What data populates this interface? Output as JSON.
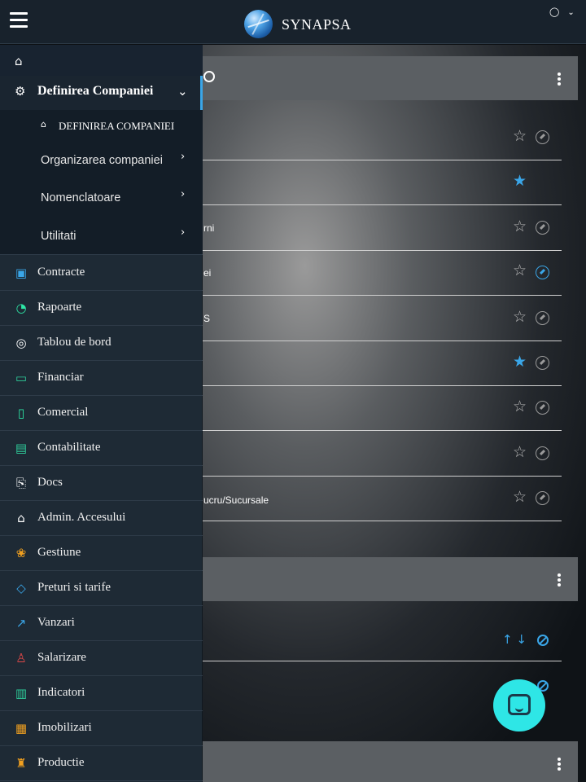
{
  "app": {
    "brand": "SYNAPSA",
    "user_icon": "user-icon",
    "user_caret": "⌄"
  },
  "sidebar": {
    "home_icon": "⌂",
    "section": {
      "label": "Definirea Companiei",
      "icon": "⚙",
      "chevron": "⌄"
    },
    "active_sub": {
      "label": "DEFINIREA COMPANIEI",
      "icon": "⌂"
    },
    "subitems": [
      {
        "label": "Organizarea companiei",
        "arrow": "›"
      },
      {
        "label": "Nomenclatoare",
        "arrow": "›"
      },
      {
        "label": "Utilitati",
        "arrow": "›"
      }
    ],
    "items": [
      {
        "label": "Contracte",
        "icon": "▣",
        "color": "#3aa6e8"
      },
      {
        "label": "Rapoarte",
        "icon": "◔",
        "color": "#2ee6a6"
      },
      {
        "label": "Tablou de bord",
        "icon": "◎",
        "color": "#ffffff"
      },
      {
        "label": "Financiar",
        "icon": "▭",
        "color": "#2ecc9a"
      },
      {
        "label": "Comercial",
        "icon": "▯",
        "color": "#2ee6a6"
      },
      {
        "label": "Contabilitate",
        "icon": "▤",
        "color": "#2ecc9a"
      },
      {
        "label": "Docs",
        "icon": "⎘",
        "color": "#ffffff"
      },
      {
        "label": "Admin. Accesului",
        "icon": "⌂",
        "color": "#ffffff"
      },
      {
        "label": "Gestiune",
        "icon": "❀",
        "color": "#f0a020"
      },
      {
        "label": "Preturi si tarife",
        "icon": "◇",
        "color": "#3aa6e8"
      },
      {
        "label": "Vanzari",
        "icon": "↗",
        "color": "#3aa6e8"
      },
      {
        "label": "Salarizare",
        "icon": "♙",
        "color": "#e04848"
      },
      {
        "label": "Indicatori",
        "icon": "▥",
        "color": "#2ecc9a"
      },
      {
        "label": "Imobilizari",
        "icon": "▦",
        "color": "#f0a020"
      },
      {
        "label": "Productie",
        "icon": "♜",
        "color": "#f0a020"
      }
    ]
  },
  "main": {
    "rows": [
      {
        "text": "",
        "star": "☆",
        "fav": false,
        "compass": true,
        "compass_active": false
      },
      {
        "text": "",
        "star": "★",
        "fav": true,
        "compass": false,
        "compass_active": false
      },
      {
        "text": "rni",
        "star": "☆",
        "fav": false,
        "compass": true,
        "compass_active": false
      },
      {
        "text": "ei",
        "star": "☆",
        "fav": false,
        "compass": true,
        "compass_active": true
      },
      {
        "text": "S",
        "star": "☆",
        "fav": false,
        "compass": true,
        "compass_active": false
      },
      {
        "text": "",
        "star": "★",
        "fav": true,
        "compass": true,
        "compass_active": false
      },
      {
        "text": "",
        "star": "☆",
        "fav": false,
        "compass": true,
        "compass_active": false
      },
      {
        "text": "",
        "star": "☆",
        "fav": false,
        "compass": true,
        "compass_active": false
      },
      {
        "text": "ucru/Sucursale",
        "star": "☆",
        "fav": false,
        "compass": true,
        "compass_active": false
      }
    ],
    "sort_arrows": "↑ ↓"
  }
}
